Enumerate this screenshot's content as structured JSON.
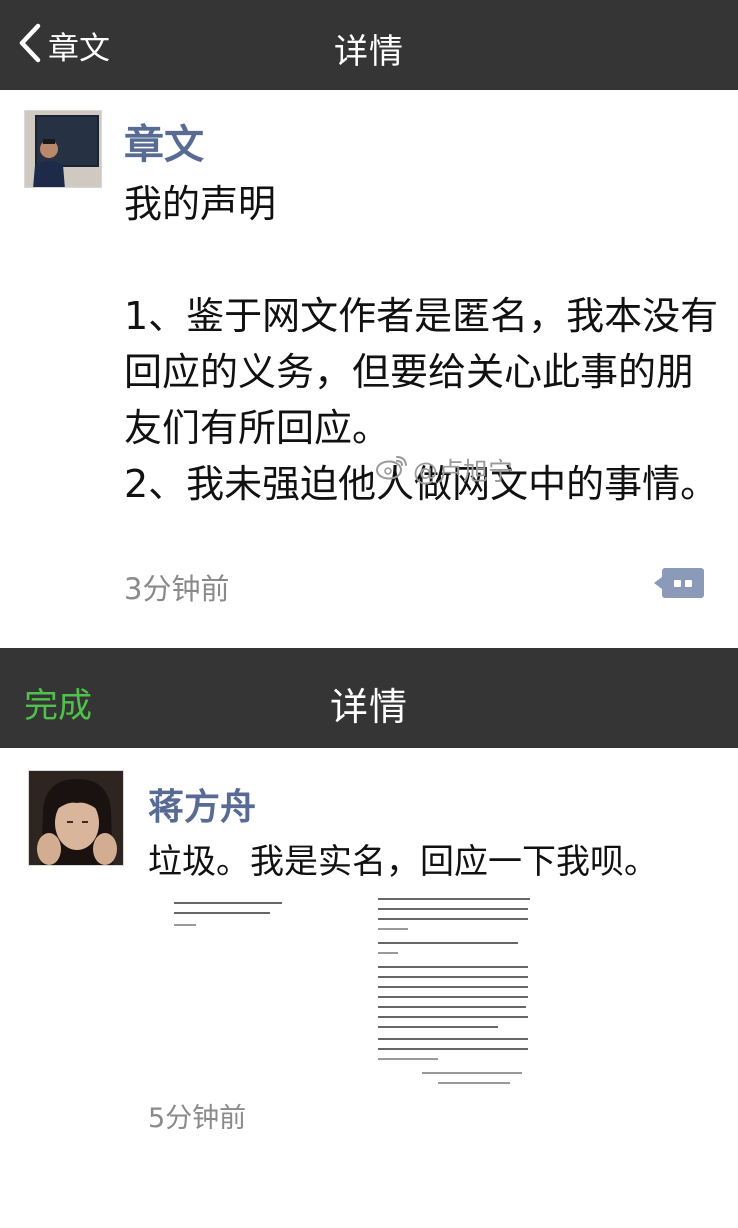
{
  "screen1": {
    "navbar": {
      "back_label": "章文",
      "title": "详情"
    },
    "post": {
      "author": "章文",
      "text": "我的声明\n\n1、鉴于网文作者是匿名，我本没有回应的义务，但要给关心此事的朋友们有所回应。\n2、我未强迫他人做网文中的事情。",
      "time": "3分钟前"
    }
  },
  "screen2": {
    "navbar": {
      "done_label": "完成",
      "title": "详情"
    },
    "post": {
      "author": "蒋方舟",
      "text": "垃圾。我是实名，回应一下我呗。",
      "time": "5分钟前"
    }
  },
  "watermark": {
    "handle": "@卢旭宁"
  },
  "colors": {
    "navbar": "#353535",
    "username": "#576b95",
    "done": "#4fc24b",
    "timestamp": "#8a8a8a"
  }
}
